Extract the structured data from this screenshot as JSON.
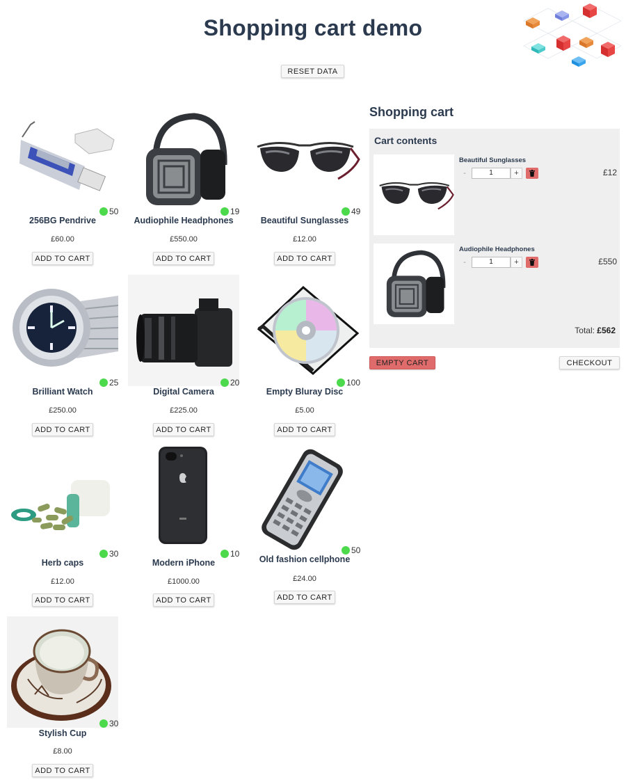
{
  "header": {
    "title": "Shopping cart demo",
    "reset_label": "RESET DATA"
  },
  "products": [
    {
      "name": "256BG Pendrive",
      "price": "£60.00",
      "stock": "50",
      "add_label": "ADD TO CART",
      "icon": "usb-drive-icon"
    },
    {
      "name": "Audiophile Headphones",
      "price": "£550.00",
      "stock": "19",
      "add_label": "ADD TO CART",
      "icon": "headphones-icon"
    },
    {
      "name": "Beautiful Sunglasses",
      "price": "£12.00",
      "stock": "49",
      "add_label": "ADD TO CART",
      "icon": "sunglasses-icon"
    },
    {
      "name": "Brilliant Watch",
      "price": "£250.00",
      "stock": "25",
      "add_label": "ADD TO CART",
      "icon": "watch-icon"
    },
    {
      "name": "Digital Camera",
      "price": "£225.00",
      "stock": "20",
      "add_label": "ADD TO CART",
      "icon": "camera-icon"
    },
    {
      "name": "Empty Bluray Disc",
      "price": "£5.00",
      "stock": "100",
      "add_label": "ADD TO CART",
      "icon": "disc-icon"
    },
    {
      "name": "Herb caps",
      "price": "£12.00",
      "stock": "30",
      "add_label": "ADD TO CART",
      "icon": "pills-icon"
    },
    {
      "name": "Modern iPhone",
      "price": "£1000.00",
      "stock": "10",
      "add_label": "ADD TO CART",
      "icon": "smartphone-icon"
    },
    {
      "name": "Old fashion cellphone",
      "price": "£24.00",
      "stock": "50",
      "add_label": "ADD TO CART",
      "icon": "cellphone-icon"
    },
    {
      "name": "Stylish Cup",
      "price": "£8.00",
      "stock": "30",
      "add_label": "ADD TO CART",
      "icon": "cup-icon"
    }
  ],
  "cart": {
    "title": "Shopping cart",
    "subtitle": "Cart contents",
    "items": [
      {
        "name": "Beautiful Sunglasses",
        "qty": "1",
        "subtotal": "£12",
        "minus": "-",
        "plus": "+"
      },
      {
        "name": "Audiophile Headphones",
        "qty": "1",
        "subtotal": "£550",
        "minus": "-",
        "plus": "+"
      }
    ],
    "total_label": "Total:",
    "total_value": "£562",
    "empty_label": "EMPTY CART",
    "checkout_label": "CHECKOUT"
  },
  "colors": {
    "title": "#2b3a4e",
    "stock_dot": "#4cd94c",
    "danger": "#e06b6b",
    "panel_bg": "#efefef"
  }
}
